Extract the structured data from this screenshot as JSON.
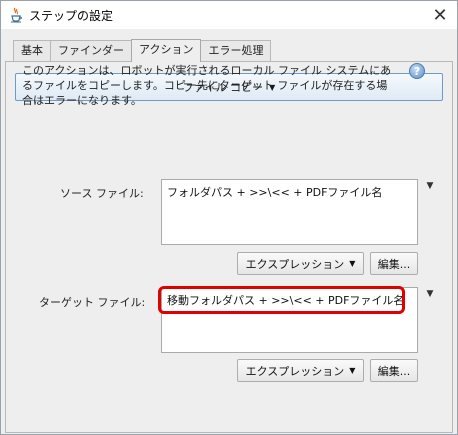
{
  "window": {
    "title": "ステップの設定",
    "close_glyph": "✕"
  },
  "tabs": [
    {
      "label": "基本",
      "active": false
    },
    {
      "label": "ファインダー",
      "active": false
    },
    {
      "label": "アクション",
      "active": true
    },
    {
      "label": "エラー処理",
      "active": false
    }
  ],
  "action": {
    "selected": "ファイル コピー",
    "arrow": "▼"
  },
  "description": "このアクションは、ロボットが実行されるローカル ファイル システムにあるファイルをコピーします。コピー先にターゲット ファイルが存在する場合はエラーになります。",
  "help_glyph": "?",
  "source": {
    "label": "ソース ファイル:",
    "value": "フォルダパス + >>\\<< + PDFファイル名",
    "expression_label": "エクスプレッション",
    "edit_label": "編集..."
  },
  "target": {
    "label": "ターゲット ファイル:",
    "value": "移動フォルダパス + >>\\<< + PDFファイル名",
    "expression_label": "エクスプレッション",
    "edit_label": "編集..."
  },
  "colors": {
    "highlight": "#e00000",
    "select_border": "#6c9cc6"
  },
  "icons": {
    "app": "java-cup-icon",
    "close": "close-icon",
    "help": "help-icon",
    "dropdown": "chevron-down-icon"
  }
}
